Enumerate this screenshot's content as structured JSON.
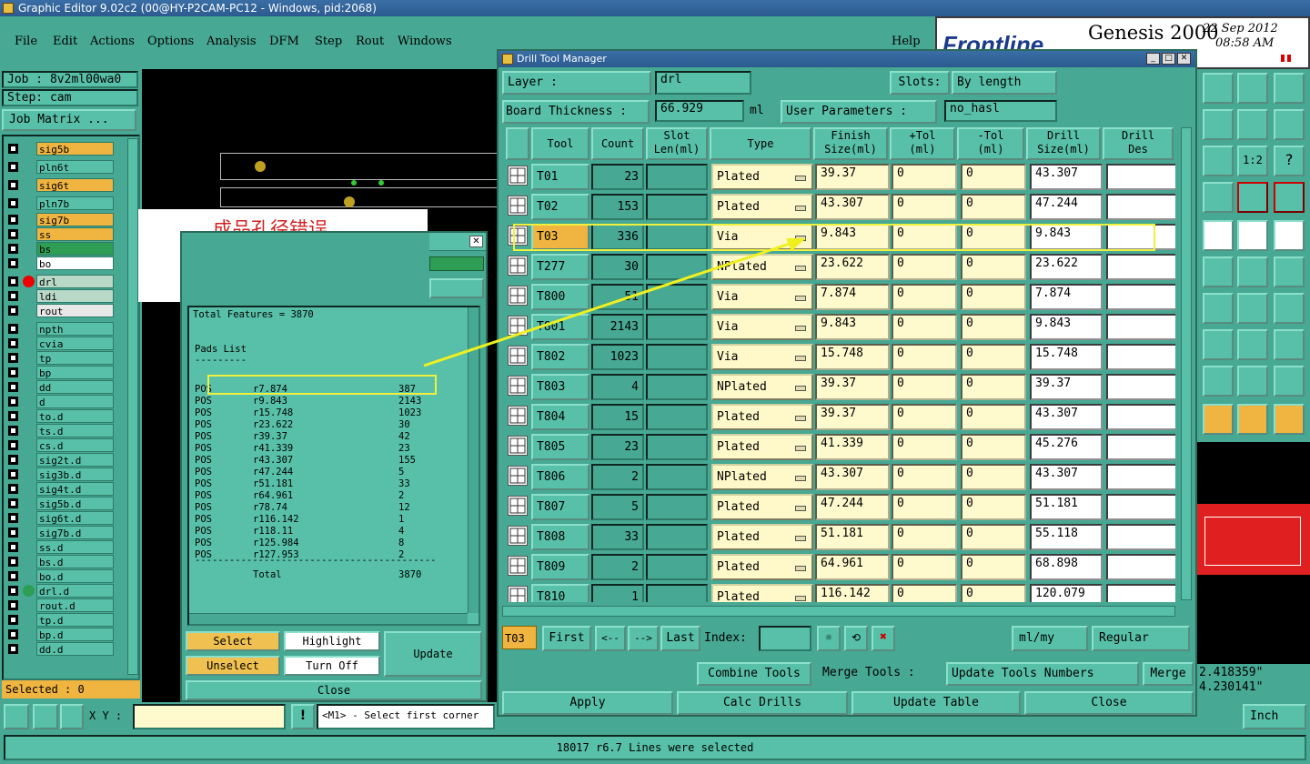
{
  "window": {
    "title": "Graphic Editor 9.02c2 (00@HY-P2CAM-PC12 - Windows, pid:2068)"
  },
  "menu": {
    "items": [
      "File",
      "Edit",
      "Actions",
      "Options",
      "Analysis",
      "DFM",
      "Step",
      "Rout",
      "Windows"
    ],
    "help": "Help"
  },
  "brand": {
    "logo": "Frontline",
    "product": "Genesis 2000",
    "date": "22 Sep 2012",
    "time": "08:58 AM"
  },
  "job": {
    "job_label": "Job : 8v2ml00wa0",
    "step_label": "Step: cam",
    "matrix_button": "Job Matrix ..."
  },
  "layers": [
    {
      "name": "sig5b",
      "color": "#f0b440"
    },
    {
      "name": "pln6t",
      "color": "#58c0a8"
    },
    {
      "name": "sig6t",
      "color": "#f0b440"
    },
    {
      "name": "pln7b",
      "color": "#58c0a8"
    },
    {
      "name": "sig7b",
      "color": "#f0b440"
    },
    {
      "name": "ss",
      "color": "#f0b440"
    },
    {
      "name": "bs",
      "color": "#2e9e54"
    },
    {
      "name": "bo",
      "color": "#ffffff"
    },
    {
      "name": "drl",
      "color": "#b8d8c8"
    },
    {
      "name": "ldi",
      "color": "#b8d8c8"
    },
    {
      "name": "rout",
      "color": "#e8e8e8"
    },
    {
      "name": "npth",
      "color": "#58c0a8"
    },
    {
      "name": "cvia",
      "color": "#58c0a8"
    },
    {
      "name": "tp",
      "color": "#58c0a8"
    },
    {
      "name": "bp",
      "color": "#58c0a8"
    },
    {
      "name": "dd",
      "color": "#58c0a8"
    },
    {
      "name": "d",
      "color": "#58c0a8"
    },
    {
      "name": "to.d",
      "color": "#58c0a8"
    },
    {
      "name": "ts.d",
      "color": "#58c0a8"
    },
    {
      "name": "cs.d",
      "color": "#58c0a8"
    },
    {
      "name": "sig2t.d",
      "color": "#58c0a8"
    },
    {
      "name": "sig3b.d",
      "color": "#58c0a8"
    },
    {
      "name": "sig4t.d",
      "color": "#58c0a8"
    },
    {
      "name": "sig5b.d",
      "color": "#58c0a8"
    },
    {
      "name": "sig6t.d",
      "color": "#58c0a8"
    },
    {
      "name": "sig7b.d",
      "color": "#58c0a8"
    },
    {
      "name": "ss.d",
      "color": "#58c0a8"
    },
    {
      "name": "bs.d",
      "color": "#58c0a8"
    },
    {
      "name": "bo.d",
      "color": "#58c0a8"
    },
    {
      "name": "drl.d",
      "color": "#58c0a8"
    },
    {
      "name": "rout.d",
      "color": "#58c0a8"
    },
    {
      "name": "tp.d",
      "color": "#58c0a8"
    },
    {
      "name": "bp.d",
      "color": "#58c0a8"
    },
    {
      "name": "dd.d",
      "color": "#58c0a8"
    }
  ],
  "selected": "Selected : 0",
  "annotation": {
    "text": "成品孔径错误"
  },
  "report": {
    "total": "Total Features = 3870",
    "pads_title": "Pads List",
    "underline": "---------",
    "rows": [
      {
        "pol": "POS",
        "sym": "r7.874",
        "count": "387"
      },
      {
        "pol": "POS",
        "sym": "r9.843",
        "count": "2143"
      },
      {
        "pol": "POS",
        "sym": "r15.748",
        "count": "1023"
      },
      {
        "pol": "POS",
        "sym": "r23.622",
        "count": "30"
      },
      {
        "pol": "POS",
        "sym": "r39.37",
        "count": "42"
      },
      {
        "pol": "POS",
        "sym": "r41.339",
        "count": "23"
      },
      {
        "pol": "POS",
        "sym": "r43.307",
        "count": "155"
      },
      {
        "pol": "POS",
        "sym": "r47.244",
        "count": "5"
      },
      {
        "pol": "POS",
        "sym": "r51.181",
        "count": "33"
      },
      {
        "pol": "POS",
        "sym": "r64.961",
        "count": "2"
      },
      {
        "pol": "POS",
        "sym": "r78.74",
        "count": "12"
      },
      {
        "pol": "POS",
        "sym": "r116.142",
        "count": "1"
      },
      {
        "pol": "POS",
        "sym": "r118.11",
        "count": "4"
      },
      {
        "pol": "POS",
        "sym": "r125.984",
        "count": "8"
      },
      {
        "pol": "POS",
        "sym": "r127.953",
        "count": "2"
      }
    ],
    "divider": "------------------------------------------",
    "total_label": "Total",
    "total_value": "3870",
    "buttons": {
      "select": "Select",
      "highlight": "Highlight",
      "update": "Update",
      "unselect": "Unselect",
      "turn_off": "Turn Off",
      "close": "Close"
    }
  },
  "dtm": {
    "title": "Drill Tool Manager",
    "layer_label": "Layer          :",
    "layer_value": "drl",
    "slots_label": "Slots:",
    "slots_value": "By length",
    "thickness_label": "Board Thickness :",
    "thickness_value": "66.929",
    "thickness_unit": "ml",
    "user_params_label": "User Parameters :",
    "user_params_value": "no_hasl",
    "headers": {
      "tool": "Tool",
      "count": "Count",
      "slot1": "Slot",
      "slot2": "Len(ml)",
      "type": "Type",
      "finish1": "Finish",
      "finish2": "Size(ml)",
      "ptol1": "+Tol",
      "ptol2": "(ml)",
      "ntol1": "-Tol",
      "ntol2": "(ml)",
      "drill1": "Drill",
      "drill2": "Size(ml)",
      "des1": "Drill",
      "des2": "Des"
    },
    "rows": [
      {
        "tool": "T01",
        "count": "23",
        "type": "Plated",
        "finish": "39.37",
        "ptol": "0",
        "ntol": "0",
        "drill": "43.307"
      },
      {
        "tool": "T02",
        "count": "153",
        "type": "Plated",
        "finish": "43.307",
        "ptol": "0",
        "ntol": "0",
        "drill": "47.244"
      },
      {
        "tool": "T03",
        "count": "336",
        "type": "Via",
        "finish": "9.843",
        "ptol": "0",
        "ntol": "0",
        "drill": "9.843"
      },
      {
        "tool": "T277",
        "count": "30",
        "type": "NPlated",
        "finish": "23.622",
        "ptol": "0",
        "ntol": "0",
        "drill": "23.622"
      },
      {
        "tool": "T800",
        "count": "51",
        "type": "Via",
        "finish": "7.874",
        "ptol": "0",
        "ntol": "0",
        "drill": "7.874"
      },
      {
        "tool": "T801",
        "count": "2143",
        "type": "Via",
        "finish": "9.843",
        "ptol": "0",
        "ntol": "0",
        "drill": "9.843"
      },
      {
        "tool": "T802",
        "count": "1023",
        "type": "Via",
        "finish": "15.748",
        "ptol": "0",
        "ntol": "0",
        "drill": "15.748"
      },
      {
        "tool": "T803",
        "count": "4",
        "type": "NPlated",
        "finish": "39.37",
        "ptol": "0",
        "ntol": "0",
        "drill": "39.37"
      },
      {
        "tool": "T804",
        "count": "15",
        "type": "Plated",
        "finish": "39.37",
        "ptol": "0",
        "ntol": "0",
        "drill": "43.307"
      },
      {
        "tool": "T805",
        "count": "23",
        "type": "Plated",
        "finish": "41.339",
        "ptol": "0",
        "ntol": "0",
        "drill": "45.276"
      },
      {
        "tool": "T806",
        "count": "2",
        "type": "NPlated",
        "finish": "43.307",
        "ptol": "0",
        "ntol": "0",
        "drill": "43.307"
      },
      {
        "tool": "T807",
        "count": "5",
        "type": "Plated",
        "finish": "47.244",
        "ptol": "0",
        "ntol": "0",
        "drill": "51.181"
      },
      {
        "tool": "T808",
        "count": "33",
        "type": "Plated",
        "finish": "51.181",
        "ptol": "0",
        "ntol": "0",
        "drill": "55.118"
      },
      {
        "tool": "T809",
        "count": "2",
        "type": "Plated",
        "finish": "64.961",
        "ptol": "0",
        "ntol": "0",
        "drill": "68.898"
      },
      {
        "tool": "T810",
        "count": "1",
        "type": "Plated",
        "finish": "116.142",
        "ptol": "0",
        "ntol": "0",
        "drill": "120.079"
      }
    ],
    "nav": {
      "current": "T03",
      "first": "First",
      "prev": "<--",
      "next": "-->",
      "last": "Last",
      "index_label": "Index:",
      "units": "ml/my",
      "mode": "Regular"
    },
    "tools": {
      "combine": "Combine Tools",
      "merge_label": "Merge Tools :",
      "update_numbers": "Update Tools Numbers",
      "merge": "Merge"
    },
    "actions": {
      "apply": "Apply",
      "calc": "Calc Drills",
      "update_table": "Update Table",
      "close": "Close"
    }
  },
  "coords": {
    "x": "2.418359\"",
    "y": "4.230141\""
  },
  "bottom": {
    "xy_label": "X Y :",
    "prompt": "<M1> - Select first corner",
    "units": "Inch",
    "status": "18017 r6.7 Lines were selected"
  }
}
